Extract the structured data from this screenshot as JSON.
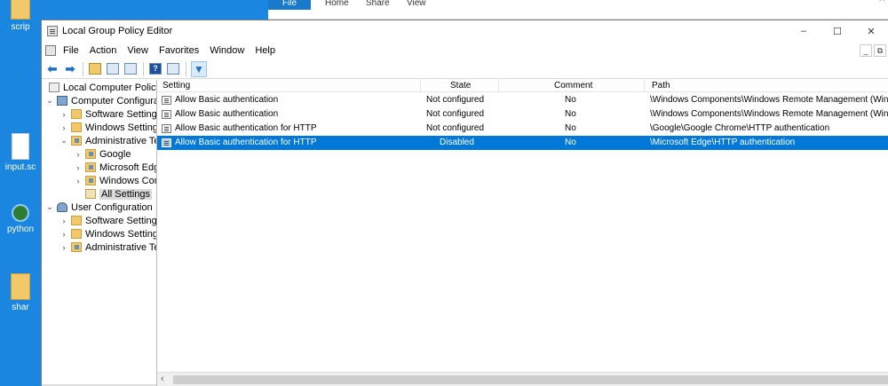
{
  "desktop": {
    "icons": [
      {
        "label": "scrip",
        "icon": "folder-icon"
      },
      {
        "label": "input.sc",
        "icon": "document-icon"
      },
      {
        "label": "python",
        "icon": "python-globe-icon"
      },
      {
        "label": "shar",
        "icon": "folder-icon"
      }
    ]
  },
  "explorer": {
    "tabs": [
      "File",
      "Home",
      "Share",
      "View"
    ]
  },
  "window": {
    "title": "Local Group Policy Editor",
    "controls": {
      "minimize": "–",
      "maximize": "☐",
      "close": "✕"
    }
  },
  "menu": {
    "items": [
      "File",
      "Action",
      "View",
      "Favorites",
      "Window",
      "Help"
    ]
  },
  "toolbar": {
    "icons": [
      "back-icon",
      "forward-icon",
      "up-folder-icon",
      "show-hide-tree-icon",
      "export-list-icon",
      "help-icon",
      "properties-icon",
      "filter-icon"
    ]
  },
  "tree": {
    "items": [
      {
        "label": "Local Computer Policy",
        "icon": "root",
        "level": 0,
        "expander": ""
      },
      {
        "label": "Computer Configurati",
        "icon": "computer",
        "level": 1,
        "expander": "⌄"
      },
      {
        "label": "Software Settings",
        "icon": "folder",
        "level": 2,
        "expander": "›"
      },
      {
        "label": "Windows Settings",
        "icon": "folder",
        "level": 2,
        "expander": "›"
      },
      {
        "label": "Administrative Ter",
        "icon": "policy",
        "level": 2,
        "expander": "⌄"
      },
      {
        "label": "Google",
        "icon": "policy",
        "level": 3,
        "expander": "›"
      },
      {
        "label": "Microsoft Edg",
        "icon": "policy",
        "level": 3,
        "expander": "›"
      },
      {
        "label": "Windows Com",
        "icon": "policy",
        "level": 3,
        "expander": "›"
      },
      {
        "label": "All Settings",
        "icon": "allsettings",
        "level": 3,
        "expander": "",
        "selected": true
      },
      {
        "label": "User Configuration",
        "icon": "user",
        "level": 1,
        "expander": "⌄"
      },
      {
        "label": "Software Settings",
        "icon": "folder",
        "level": 2,
        "expander": "›"
      },
      {
        "label": "Windows Settings",
        "icon": "folder",
        "level": 2,
        "expander": "›"
      },
      {
        "label": "Administrative Ter",
        "icon": "policy",
        "level": 2,
        "expander": "›"
      }
    ]
  },
  "list": {
    "columns": {
      "setting": "Setting",
      "state": "State",
      "comment": "Comment",
      "path": "Path"
    },
    "rows": [
      {
        "setting": "Allow Basic authentication",
        "state": "Not configured",
        "comment": "No",
        "path": "\\Windows Components\\Windows Remote Management (WinR",
        "selected": false
      },
      {
        "setting": "Allow Basic authentication",
        "state": "Not configured",
        "comment": "No",
        "path": "\\Windows Components\\Windows Remote Management (WinR",
        "selected": false
      },
      {
        "setting": "Allow Basic authentication for HTTP",
        "state": "Not configured",
        "comment": "No",
        "path": "\\Google\\Google Chrome\\HTTP authentication",
        "selected": false
      },
      {
        "setting": "Allow Basic authentication for HTTP",
        "state": "Disabled",
        "comment": "No",
        "path": "\\Microsoft Edge\\HTTP authentication",
        "selected": true
      }
    ]
  },
  "colors": {
    "selection": "#0078d7",
    "desktop": "#1a86e0"
  }
}
